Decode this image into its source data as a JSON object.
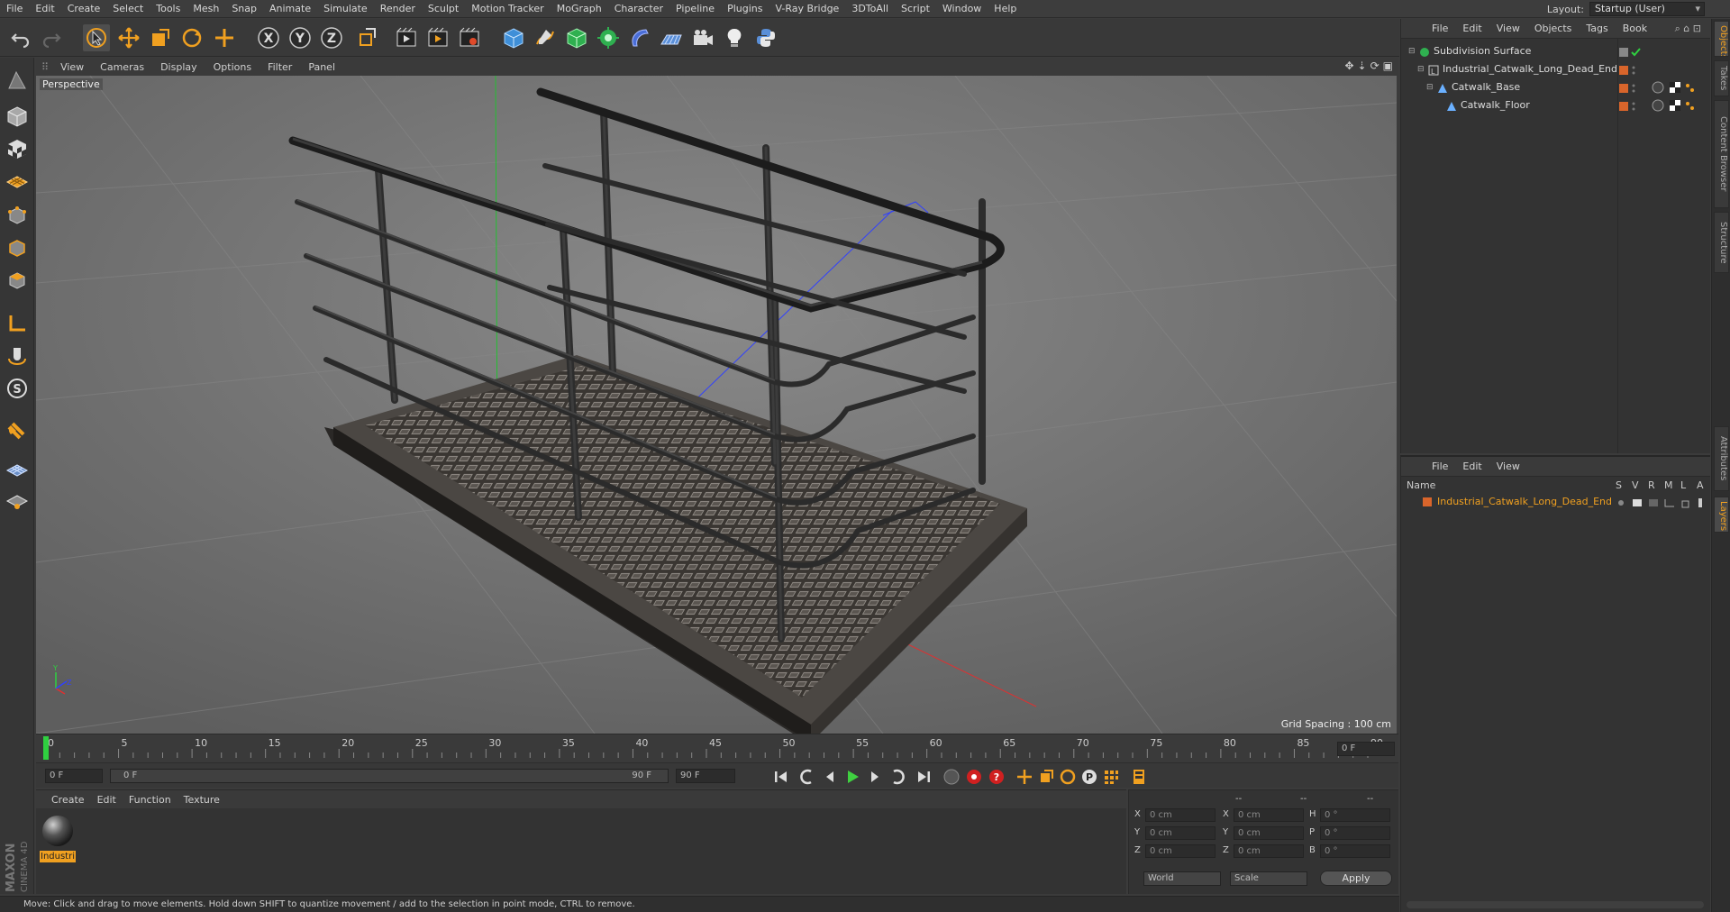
{
  "menubar": {
    "items": [
      "File",
      "Edit",
      "Create",
      "Select",
      "Tools",
      "Mesh",
      "Snap",
      "Animate",
      "Simulate",
      "Render",
      "Sculpt",
      "Motion Tracker",
      "MoGraph",
      "Character",
      "Pipeline",
      "Plugins",
      "V-Ray Bridge",
      "3DToAll",
      "Script",
      "Window",
      "Help"
    ],
    "layout_label": "Layout:",
    "layout_value": "Startup (User)"
  },
  "viewport": {
    "menu": [
      "View",
      "Cameras",
      "Display",
      "Options",
      "Filter",
      "Panel"
    ],
    "camera_label": "Perspective",
    "grid_spacing": "Grid Spacing : 100 cm"
  },
  "timeline": {
    "ticks": [
      "0",
      "5",
      "10",
      "15",
      "20",
      "25",
      "30",
      "35",
      "40",
      "45",
      "50",
      "55",
      "60",
      "65",
      "70",
      "75",
      "80",
      "85",
      "90"
    ],
    "current_frame_field": "0 F",
    "start_field": "0 F",
    "range_start": "0 F",
    "range_end": "90 F",
    "end_field": "90 F"
  },
  "material_manager": {
    "menu": [
      "Create",
      "Edit",
      "Function",
      "Texture"
    ],
    "material_name": "Industri"
  },
  "coordinates": {
    "headers": [
      "--",
      "--",
      "--"
    ],
    "rows": [
      {
        "l1": "X",
        "v1": "0 cm",
        "l2": "X",
        "v2": "0 cm",
        "l3": "H",
        "v3": "0 °"
      },
      {
        "l1": "Y",
        "v1": "0 cm",
        "l2": "Y",
        "v2": "0 cm",
        "l3": "P",
        "v3": "0 °"
      },
      {
        "l1": "Z",
        "v1": "0 cm",
        "l2": "Z",
        "v2": "0 cm",
        "l3": "B",
        "v3": "0 °"
      }
    ],
    "mode_world": "World",
    "mode_scale": "Scale",
    "apply": "Apply"
  },
  "status": "Move: Click and drag to move elements. Hold down SHIFT to quantize movement / add to the selection in point mode, CTRL to remove.",
  "object_manager": {
    "menu": [
      "File",
      "Edit",
      "View",
      "Objects",
      "Tags",
      "Book"
    ],
    "objects": [
      {
        "name": "Subdivision Surface",
        "indent": 0
      },
      {
        "name": "Industrial_Catwalk_Long_Dead_End",
        "indent": 1
      },
      {
        "name": "Catwalk_Base",
        "indent": 2
      },
      {
        "name": "Catwalk_Floor",
        "indent": 3
      }
    ]
  },
  "layer_manager": {
    "menu": [
      "File",
      "Edit",
      "View"
    ],
    "columns": [
      "Name",
      "S",
      "V",
      "R",
      "M",
      "L",
      "A"
    ],
    "layers": [
      {
        "name": "Industrial_Catwalk_Long_Dead_End",
        "color": "#d9652b"
      }
    ]
  },
  "right_tabs": [
    "Objects",
    "Takes",
    "Content Browser",
    "Structure",
    "Attributes",
    "Layers"
  ],
  "branding": {
    "maxon": "MAXON",
    "product": "CINEMA 4D"
  },
  "colors": {
    "accent": "#f0a020",
    "layer_orange": "#d9652b",
    "selected_text": "#f0a020"
  }
}
